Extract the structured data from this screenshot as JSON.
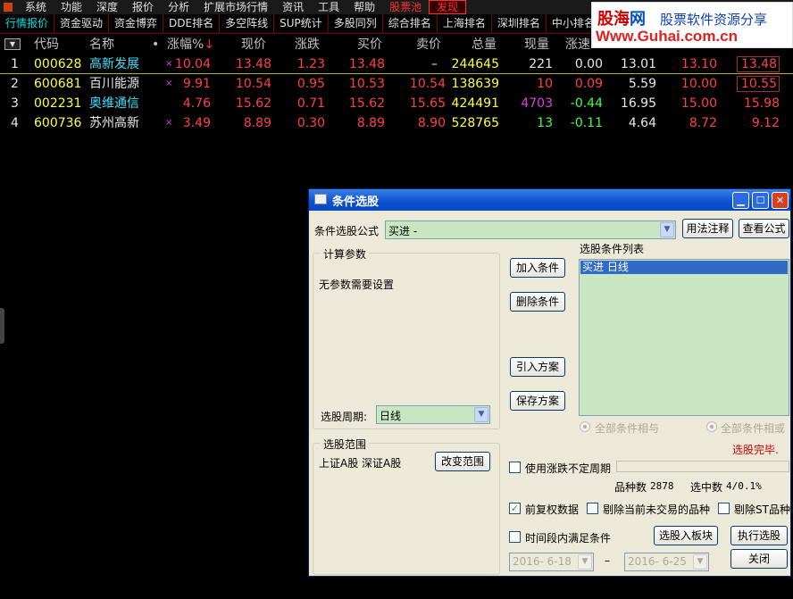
{
  "menubar": {
    "items": [
      "系统",
      "功能",
      "深度",
      "报价",
      "分析",
      "扩展市场行情",
      "资讯",
      "工具",
      "帮助"
    ],
    "pool": "股票池",
    "discover": "发现"
  },
  "tabs": [
    "行情报价",
    "资金驱动",
    "资金博弈",
    "DDE排名",
    "多空阵线",
    "SUP统计",
    "多股同列",
    "综合排名",
    "上海排名",
    "深圳排名",
    "中小排名"
  ],
  "watermark": {
    "brand_a": "股海",
    "brand_b": "网",
    "slogan": "股票软件资源分享",
    "url": "Www.Guhai.com.cn"
  },
  "grid": {
    "dropdown": "▼",
    "headers": {
      "code": "代码",
      "name": "名称",
      "dot": "•",
      "change_pct": "涨幅%",
      "sort_arrow": "↓",
      "price": "现价",
      "change": "涨跌",
      "bid": "买价",
      "ask": "卖价",
      "volume": "总量",
      "cur_vol": "现量",
      "speed": "涨速"
    },
    "rows": [
      {
        "idx": "1",
        "code": "000628",
        "name": "高新发展",
        "mark": "×",
        "pct": "10.04",
        "price": "13.48",
        "chg": "1.23",
        "bid": "13.48",
        "ask": "–",
        "vol": "244645",
        "cur": "221",
        "speed": "0.00",
        "o": "13.01",
        "h": "13.10",
        "l": "13.48"
      },
      {
        "idx": "2",
        "code": "600681",
        "name": "百川能源",
        "mark": "×",
        "pct": "9.91",
        "price": "10.54",
        "chg": "0.95",
        "bid": "10.53",
        "ask": "10.54",
        "vol": "138639",
        "cur": "10",
        "speed": "0.09",
        "o": "5.59",
        "h": "10.00",
        "l": "10.55"
      },
      {
        "idx": "3",
        "code": "002231",
        "name": "奥维通信",
        "mark": "",
        "pct": "4.76",
        "price": "15.62",
        "chg": "0.71",
        "bid": "15.62",
        "ask": "15.65",
        "vol": "424491",
        "cur": "4703",
        "speed": "-0.44",
        "o": "16.95",
        "h": "15.00",
        "l": "15.98"
      },
      {
        "idx": "4",
        "code": "600736",
        "name": "苏州高新",
        "mark": "×",
        "pct": "3.49",
        "price": "8.89",
        "chg": "0.30",
        "bid": "8.89",
        "ask": "8.90",
        "vol": "528765",
        "cur": "13",
        "speed": "-0.11",
        "o": "4.64",
        "h": "8.72",
        "l": "9.12"
      }
    ]
  },
  "dialog": {
    "title": "条件选股",
    "formula_label": "条件选股公式",
    "formula_value": "买进        -",
    "usage_btn": "用法注释",
    "view_btn": "查看公式",
    "params_group": "计算参数",
    "no_params": "无参数需要设置",
    "period_label": "选股周期:",
    "period_value": "日线",
    "list_label": "选股条件列表",
    "list_item": "买进   日线",
    "add_btn": "加入条件",
    "del_btn": "删除条件",
    "import_btn": "引入方案",
    "save_btn": "保存方案",
    "and_label": "全部条件相与",
    "or_label": "全部条件相或",
    "done": "选股完毕.",
    "scope_group": "选股范围",
    "scope_value": "上证A股  深证A股",
    "change_scope_btn": "改变范围",
    "use_period_label": "使用涨跌不定周期",
    "count_label": "品种数",
    "count_value": "2878",
    "selected_label": "选中数",
    "selected_value": "4/0.1%",
    "fq_label": "前复权数据",
    "fq_check": "✓",
    "exclude_label": "剔除当前未交易的品种",
    "exclude_st_label": "剔除ST品种",
    "period_range_label": "时间段内满足条件",
    "to_board_btn": "选股入板块",
    "run_btn": "执行选股",
    "close_btn": "关闭",
    "date_from": "2016- 6-18",
    "date_sep": "–",
    "date_to": "2016- 6-25"
  }
}
